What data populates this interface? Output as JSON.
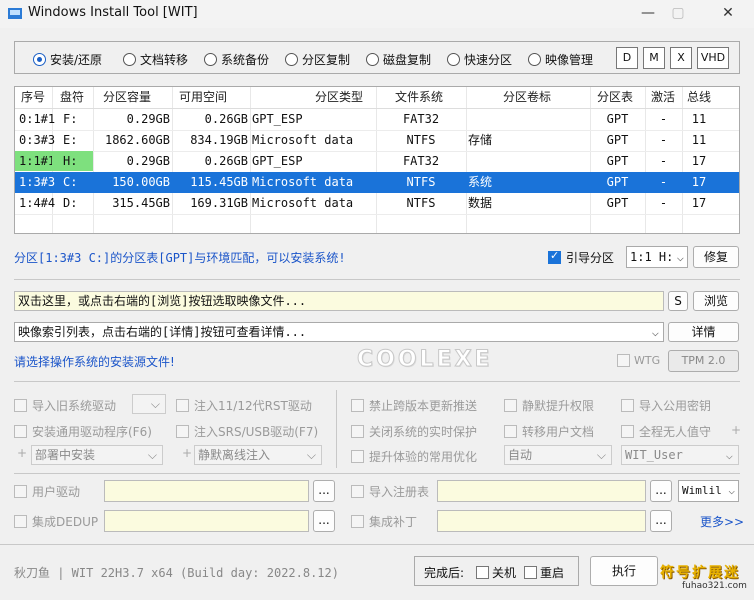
{
  "window": {
    "title": "Windows Install Tool [WIT]",
    "min": "—",
    "max": "▢",
    "close": "✕"
  },
  "modes": [
    {
      "label": "安装/还原",
      "selected": true
    },
    {
      "label": "文档转移",
      "selected": false
    },
    {
      "label": "系统备份",
      "selected": false
    },
    {
      "label": "分区复制",
      "selected": false
    },
    {
      "label": "磁盘复制",
      "selected": false
    },
    {
      "label": "快速分区",
      "selected": false
    },
    {
      "label": "映像管理",
      "selected": false
    }
  ],
  "mode_buttons": [
    "D",
    "M",
    "X",
    "VHD"
  ],
  "table": {
    "headers": [
      "序号",
      "盘符",
      "分区容量",
      "可用空间",
      "分区类型",
      "文件系统",
      "分区卷标",
      "分区表",
      "激活",
      "总线"
    ],
    "rows": [
      {
        "id": "0:1#1",
        "drive": "F:",
        "size": "0.29GB",
        "free": "0.26GB",
        "type": "GPT_ESP",
        "fs": "FAT32",
        "label": "",
        "pt": "GPT",
        "active": "-",
        "bus": "11"
      },
      {
        "id": "0:3#3",
        "drive": "E:",
        "size": "1862.60GB",
        "free": "834.19GB",
        "type": "Microsoft data",
        "fs": "NTFS",
        "label": "存储",
        "pt": "GPT",
        "active": "-",
        "bus": "11"
      },
      {
        "id": "1:1#1",
        "drive": "H:",
        "size": "0.29GB",
        "free": "0.26GB",
        "type": "GPT_ESP",
        "fs": "FAT32",
        "label": "",
        "pt": "GPT",
        "active": "-",
        "bus": "17"
      },
      {
        "id": "1:3#3",
        "drive": "C:",
        "size": "150.00GB",
        "free": "115.45GB",
        "type": "Microsoft data",
        "fs": "NTFS",
        "label": "系统",
        "pt": "GPT",
        "active": "-",
        "bus": "17"
      },
      {
        "id": "1:4#4",
        "drive": "D:",
        "size": "315.45GB",
        "free": "169.31GB",
        "type": "Microsoft data",
        "fs": "NTFS",
        "label": "数据",
        "pt": "GPT",
        "active": "-",
        "bus": "17"
      }
    ],
    "highlight_color": "#7ee07e",
    "selected_color": "#1a73d9"
  },
  "status": {
    "message": "分区[1:3#3 C:]的分区表[GPT]与环境匹配，可以安装系统!",
    "boot_label": "引导分区",
    "boot_value": "1:1 H:",
    "repair": "修复"
  },
  "image": {
    "path_placeholder": "双击这里，或点击右端的[浏览]按钮选取映像文件...",
    "s_button": "S",
    "browse": "浏览",
    "index_placeholder": "映像索引列表，点击右端的[详情]按钮可查看详情...",
    "details": "详情",
    "hint": "请选择操作系统的安装源文件!",
    "logo": "COOLEXE",
    "wtg": "WTG",
    "tpm": "TPM 2.0"
  },
  "options": {
    "left": [
      {
        "label": "导入旧系统驱动"
      },
      {
        "label": "安装通用驱动程序(F6)"
      },
      {
        "label": "部署中安装"
      }
    ],
    "mid": [
      {
        "label": "注入11/12代RST驱动"
      },
      {
        "label": "注入SRS/USB驱动(F7)"
      },
      {
        "label": "静默离线注入"
      }
    ],
    "right1": [
      {
        "label": "禁止跨版本更新推送"
      },
      {
        "label": "关闭系统的实时保护"
      },
      {
        "label": "提升体验的常用优化"
      }
    ],
    "right2": [
      {
        "label": "静默提升权限"
      },
      {
        "label": "转移用户文档"
      },
      {
        "label": "自动"
      }
    ],
    "right3": [
      {
        "label": "导入公用密钥"
      },
      {
        "label": "全程无人值守"
      },
      {
        "label": "WIT_User"
      }
    ],
    "plus": "+"
  },
  "extras": {
    "user_driver": "用户驱动",
    "dedup": "集成DEDUP",
    "reg": "导入注册表",
    "patch": "集成补丁",
    "dots": "...",
    "winlil": "Wimlil",
    "more": "更多>>"
  },
  "footer": {
    "version": "秋刀鱼 | WIT 22H3.7 x64 (Build day: 2022.8.12)",
    "after": "完成后:",
    "shutdown": "关机",
    "restart": "重启",
    "execute": "执行",
    "watermark": "符号扩展迷",
    "watermark_sub": "fuhao321.com"
  }
}
